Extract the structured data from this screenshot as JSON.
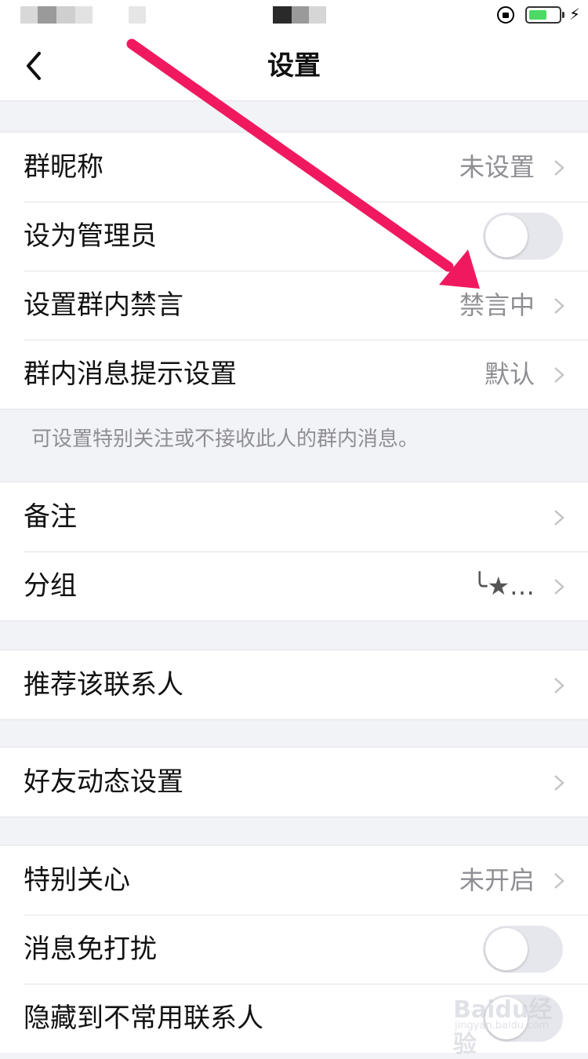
{
  "header": {
    "title": "设置"
  },
  "group1": {
    "rows": [
      {
        "label": "群昵称",
        "value": "未设置"
      },
      {
        "label": "设为管理员",
        "toggle": false
      },
      {
        "label": "设置群内禁言",
        "value": "禁言中"
      },
      {
        "label": "群内消息提示设置",
        "value": "默认"
      }
    ],
    "hint": "可设置特别关注或不接收此人的群内消息。"
  },
  "group2": {
    "rows": [
      {
        "label": "备注"
      },
      {
        "label": "分组",
        "value": "╰★…"
      }
    ]
  },
  "group3": {
    "rows": [
      {
        "label": "推荐该联系人"
      }
    ]
  },
  "group4": {
    "rows": [
      {
        "label": "好友动态设置"
      }
    ]
  },
  "group5": {
    "rows": [
      {
        "label": "特别关心",
        "value": "未开启"
      },
      {
        "label": "消息免打扰",
        "toggle": false
      },
      {
        "label": "隐藏到不常用联系人",
        "toggle": false
      }
    ]
  },
  "watermark": {
    "logo": "Baidu经验",
    "url": "jingyan.baidu.com"
  },
  "colors": {
    "arrow": "#f0195f",
    "battery": "#4cd964",
    "toggle_off": "#e6e7ec"
  },
  "icons": {
    "back": "chevron-left-icon",
    "row_chevron": "chevron-right-icon"
  }
}
